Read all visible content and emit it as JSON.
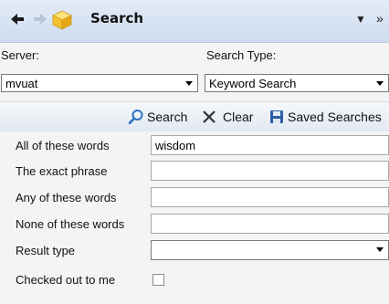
{
  "titlebar": {
    "title": "Search",
    "icons": {
      "back": "back-arrow-icon",
      "forward": "forward-arrow-icon",
      "app": "search-cube-icon",
      "dropdown": "dropdown-icon",
      "overflow": "overflow-chevron-icon"
    }
  },
  "server": {
    "label": "Server:",
    "value": "mvuat"
  },
  "search_type": {
    "label": "Search Type:",
    "value": "Keyword Search"
  },
  "toolbar": {
    "search_label": "Search",
    "clear_label": "Clear",
    "saved_label": "Saved Searches"
  },
  "form": {
    "all_words": {
      "label": "All of these words",
      "value": "wisdom"
    },
    "exact_phrase": {
      "label": "The exact phrase",
      "value": ""
    },
    "any_words": {
      "label": "Any of these words",
      "value": ""
    },
    "none_words": {
      "label": "None of these words",
      "value": ""
    },
    "result_type": {
      "label": "Result type",
      "value": ""
    },
    "checked_out": {
      "label": "Checked out to me",
      "checked": false
    }
  },
  "colors": {
    "titlebar_top": "#e4ecf7",
    "titlebar_bottom": "#cddcef",
    "panel_bg": "#f4f4f4",
    "accent_blue": "#2c6fc4"
  }
}
